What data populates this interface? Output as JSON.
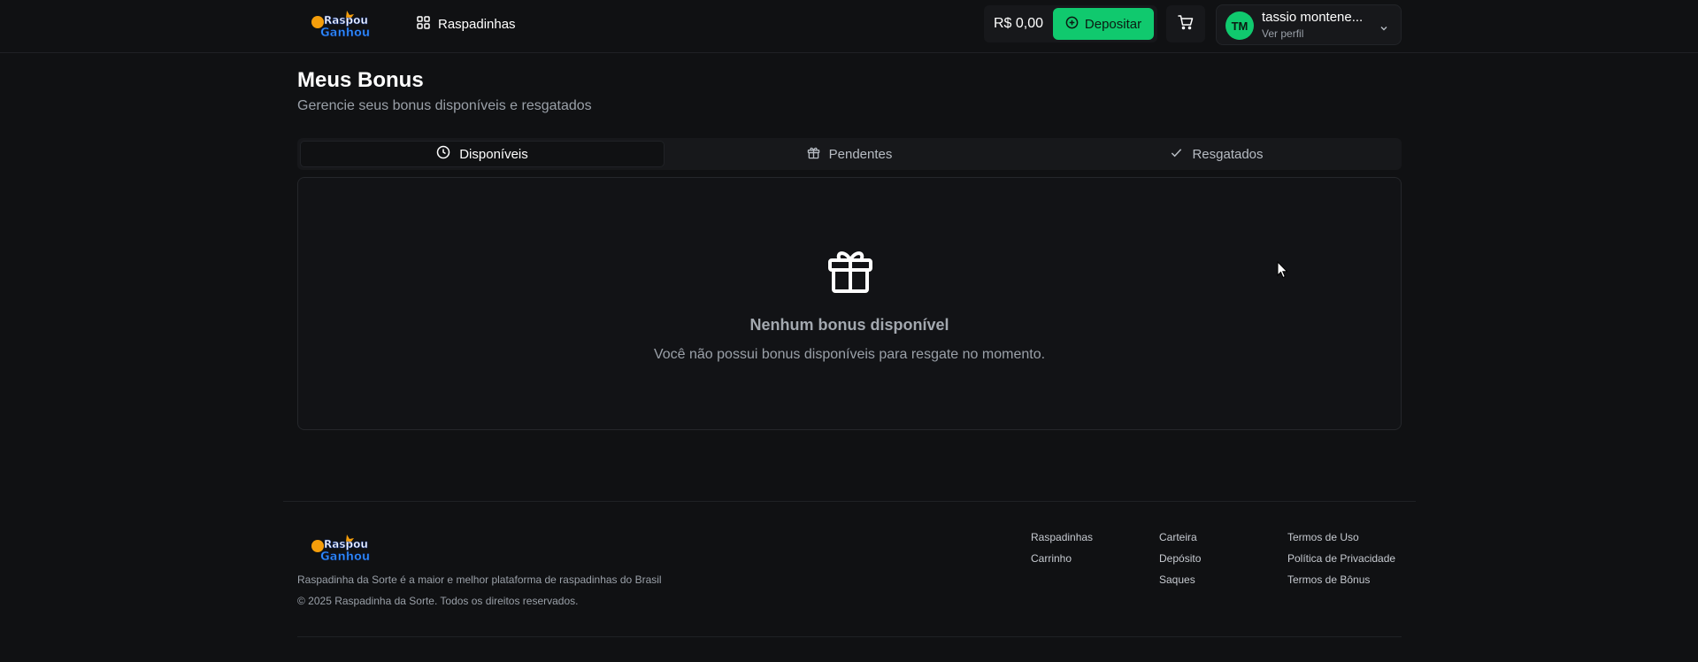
{
  "header": {
    "logo_text": [
      "Raspou",
      "Ganhou"
    ],
    "nav_label": "Raspadinhas",
    "balance": "R$ 0,00",
    "deposit_label": "Depositar",
    "profile": {
      "initials": "TM",
      "name": "tassio montene...",
      "subtitle": "Ver perfil"
    }
  },
  "main": {
    "title": "Meus Bonus",
    "subtitle": "Gerencie seus bonus disponíveis e resgatados",
    "tabs": [
      {
        "label": "Disponíveis",
        "icon": "clock-icon",
        "active": true
      },
      {
        "label": "Pendentes",
        "icon": "gift-icon",
        "active": false
      },
      {
        "label": "Resgatados",
        "icon": "check-icon",
        "active": false
      }
    ],
    "empty_state": {
      "title": "Nenhum bonus disponível",
      "text": "Você não possui bonus disponíveis para resgate no momento."
    }
  },
  "footer": {
    "description": "Raspadinha da Sorte é a maior e melhor plataforma de raspadinhas do Brasil",
    "copyright": "© 2025 Raspadinha da Sorte. Todos os direitos reservados.",
    "columns": [
      [
        "Raspadinhas",
        "Carrinho"
      ],
      [
        "Carteira",
        "Depósito",
        "Saques"
      ],
      [
        "Termos de Uso",
        "Política de Privacidade",
        "Termos de Bônus"
      ]
    ]
  },
  "colors": {
    "background": "#101113",
    "accent": "#10c96e",
    "muted_text": "#9aa0a8"
  }
}
